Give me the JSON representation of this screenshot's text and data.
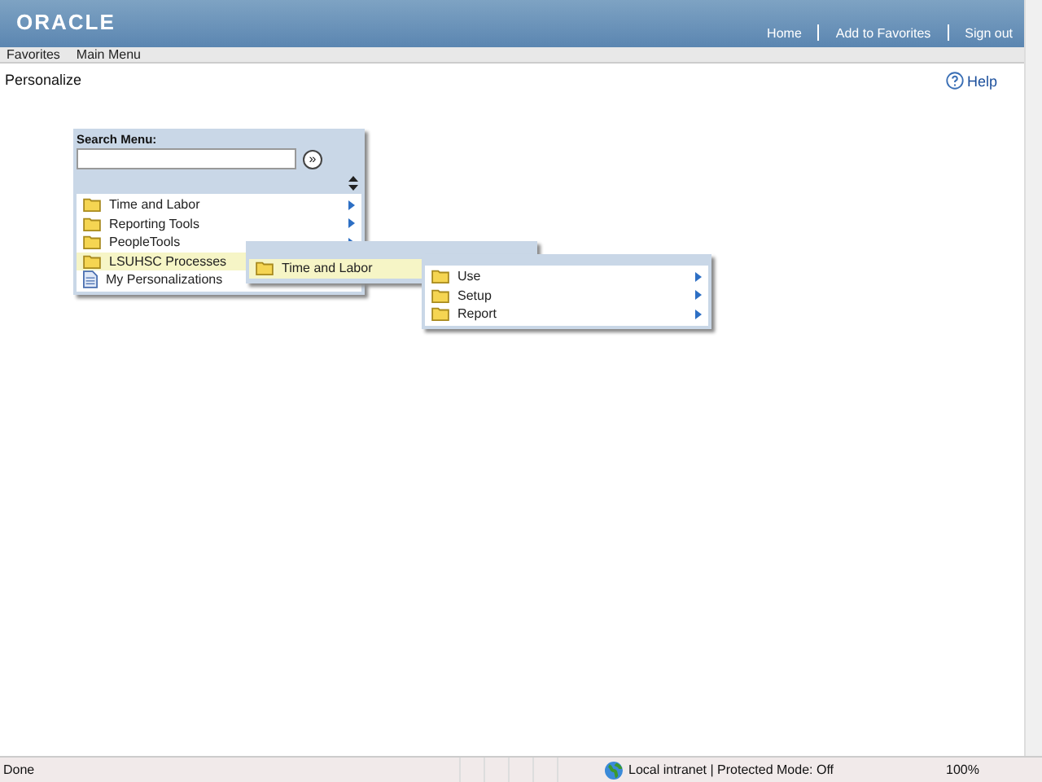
{
  "header": {
    "logo": "ORACLE",
    "links": [
      "Home",
      "Add to Favorites",
      "Sign out"
    ]
  },
  "menubar": [
    "Favorites",
    "Main Menu"
  ],
  "page": {
    "title": "Personalize",
    "help": "Help"
  },
  "menus": [
    {
      "search_label": "Search Menu:",
      "go": "»",
      "items": [
        {
          "label": "Time and Labor",
          "kind": "folder",
          "selected": false,
          "submenu": true
        },
        {
          "label": "Reporting Tools",
          "kind": "folder",
          "selected": false,
          "submenu": true
        },
        {
          "label": "PeopleTools",
          "kind": "folder",
          "selected": false,
          "submenu": true
        },
        {
          "label": "LSUHSC Processes",
          "kind": "folder",
          "selected": true,
          "submenu": false
        },
        {
          "label": "My Personalizations",
          "kind": "page",
          "selected": false,
          "submenu": false
        }
      ]
    },
    {
      "items": [
        {
          "label": "Time and Labor",
          "kind": "folder",
          "selected": true,
          "submenu": false
        }
      ]
    },
    {
      "items": [
        {
          "label": "Use",
          "kind": "folder",
          "selected": false,
          "submenu": true
        },
        {
          "label": "Setup",
          "kind": "folder",
          "selected": false,
          "submenu": true
        },
        {
          "label": "Report",
          "kind": "folder",
          "selected": false,
          "submenu": true
        }
      ]
    }
  ],
  "status_bar": {
    "text": "Done",
    "zone": "Local intranet | Protected Mode: Off",
    "zoom": "100%"
  }
}
